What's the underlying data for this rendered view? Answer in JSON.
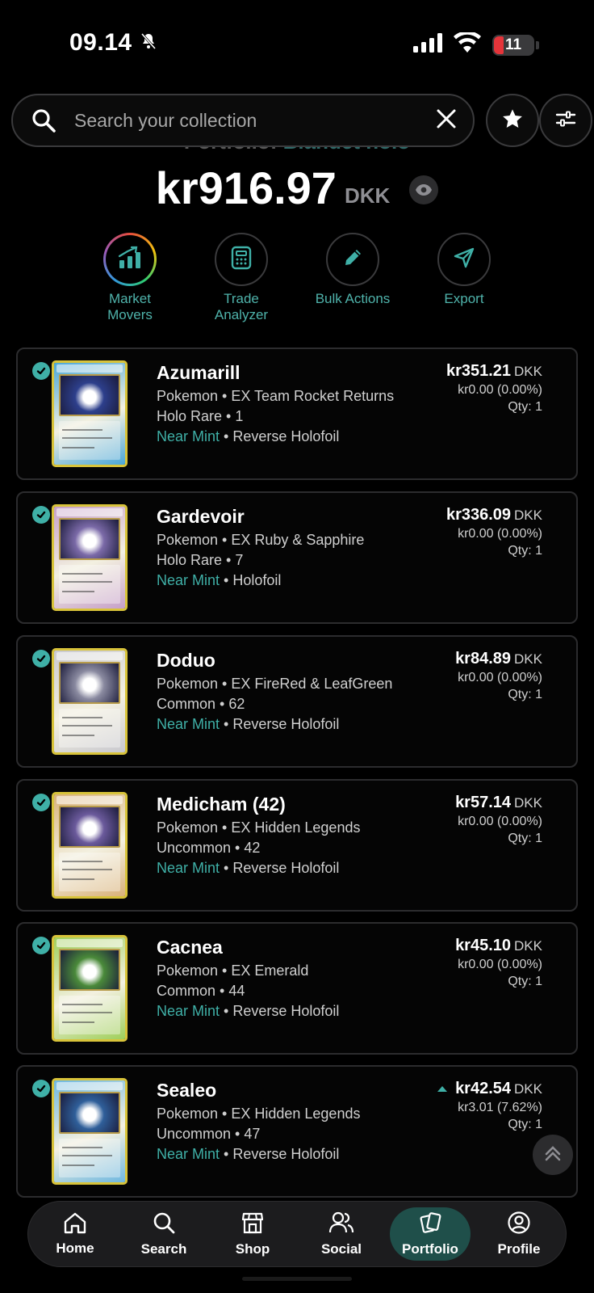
{
  "status_bar": {
    "time": "09.14",
    "battery": "11"
  },
  "search": {
    "placeholder": "Search your collection"
  },
  "portfolio": {
    "label": "Portfolio:",
    "name": "Blandet holo",
    "total_value": "kr916.97",
    "currency": "DKK"
  },
  "actions": [
    {
      "label": "Market\nMovers",
      "icon": "chart-icon"
    },
    {
      "label": "Trade\nAnalyzer",
      "icon": "calculator-icon"
    },
    {
      "label": "Bulk Actions",
      "icon": "pencil-icon"
    },
    {
      "label": "Export",
      "icon": "send-icon"
    }
  ],
  "cards": [
    {
      "name": "Azumarill",
      "line1": "Pokemon • EX Team Rocket Returns",
      "line2": "Holo Rare • 1",
      "condition": "Near Mint",
      "finish": " • Reverse Holofoil",
      "price": "kr351.21",
      "currency": "DKK",
      "change": "kr0.00 (0.00%)",
      "qty": "Qty: 1",
      "trend_up": false,
      "thumb_color": "#4aa7d8",
      "art_color": "#2d3f8c"
    },
    {
      "name": "Gardevoir",
      "line1": "Pokemon • EX Ruby & Sapphire",
      "line2": "Holo Rare • 7",
      "condition": "Near Mint",
      "finish": " • Holofoil",
      "price": "kr336.09",
      "currency": "DKK",
      "change": "kr0.00 (0.00%)",
      "qty": "Qty: 1",
      "trend_up": false,
      "thumb_color": "#c6a0c9",
      "art_color": "#7b6aa8"
    },
    {
      "name": "Doduo",
      "line1": "Pokemon • EX FireRed & LeafGreen",
      "line2": "Common • 62",
      "condition": "Near Mint",
      "finish": " • Reverse Holofoil",
      "price": "kr84.89",
      "currency": "DKK",
      "change": "kr0.00 (0.00%)",
      "qty": "Qty: 1",
      "trend_up": false,
      "thumb_color": "#c9c9cf",
      "art_color": "#8a8aa0"
    },
    {
      "name": "Medicham (42)",
      "line1": "Pokemon • EX Hidden Legends",
      "line2": "Uncommon • 42",
      "condition": "Near Mint",
      "finish": " • Reverse Holofoil",
      "price": "kr57.14",
      "currency": "DKK",
      "change": "kr0.00 (0.00%)",
      "qty": "Qty: 1",
      "trend_up": false,
      "thumb_color": "#d9b27a",
      "art_color": "#6b5a9c"
    },
    {
      "name": "Cacnea",
      "line1": "Pokemon • EX Emerald",
      "line2": "Common • 44",
      "condition": "Near Mint",
      "finish": " • Reverse Holofoil",
      "price": "kr45.10",
      "currency": "DKK",
      "change": "kr0.00 (0.00%)",
      "qty": "Qty: 1",
      "trend_up": false,
      "thumb_color": "#9fcf5a",
      "art_color": "#4a8a3a"
    },
    {
      "name": "Sealeo",
      "line1": "Pokemon • EX Hidden Legends",
      "line2": "Uncommon • 47",
      "condition": "Near Mint",
      "finish": " • Reverse Holofoil",
      "price": "kr42.54",
      "currency": "DKK",
      "change": "kr3.01 (7.62%)",
      "qty": "Qty: 1",
      "trend_up": true,
      "thumb_color": "#6fb8e0",
      "art_color": "#2f5f9a"
    }
  ],
  "nav": [
    {
      "label": "Home",
      "icon": "home-icon",
      "active": false
    },
    {
      "label": "Search",
      "icon": "search-icon",
      "active": false
    },
    {
      "label": "Shop",
      "icon": "shop-icon",
      "active": false
    },
    {
      "label": "Social",
      "icon": "users-icon",
      "active": false
    },
    {
      "label": "Portfolio",
      "icon": "cards-icon",
      "active": true
    },
    {
      "label": "Profile",
      "icon": "profile-icon",
      "active": false
    }
  ],
  "colors": {
    "accent": "#3fb0a7",
    "active_nav": "#1f4f4a",
    "background": "#000000"
  }
}
